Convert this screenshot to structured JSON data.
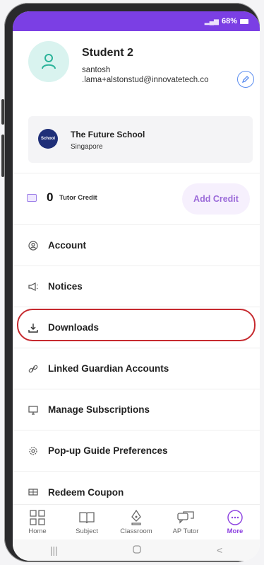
{
  "status_bar": {
    "battery": "68%"
  },
  "profile": {
    "name": "Student 2",
    "email_line1": "santosh",
    "email_line2": ".lama+alstonstud@innovatetech.co"
  },
  "school": {
    "name": "The Future School",
    "location": "Singapore",
    "logo_text": "School"
  },
  "credit": {
    "value": "0",
    "label": "Tutor Credit",
    "add_label": "Add Credit"
  },
  "menu": {
    "items": [
      {
        "label": "Account",
        "icon": "user-circle-icon"
      },
      {
        "label": "Notices",
        "icon": "megaphone-icon"
      },
      {
        "label": "Downloads",
        "icon": "download-icon"
      },
      {
        "label": "Linked Guardian Accounts",
        "icon": "link-icon"
      },
      {
        "label": "Manage Subscriptions",
        "icon": "monitor-icon"
      },
      {
        "label": "Pop-up Guide Preferences",
        "icon": "gear-icon"
      },
      {
        "label": "Redeem Coupon",
        "icon": "ticket-icon"
      }
    ]
  },
  "bottom_nav": {
    "items": [
      {
        "label": "Home",
        "icon": "grid-icon"
      },
      {
        "label": "Subject",
        "icon": "book-icon"
      },
      {
        "label": "Classroom",
        "icon": "pen-icon"
      },
      {
        "label": "AP Tutor",
        "icon": "chat-icon"
      },
      {
        "label": "More",
        "icon": "more-icon"
      }
    ],
    "active": "More"
  },
  "colors": {
    "accent": "#7b3fe4",
    "highlight_outline": "#c62a2f",
    "add_credit_text": "#9b6ad9"
  }
}
